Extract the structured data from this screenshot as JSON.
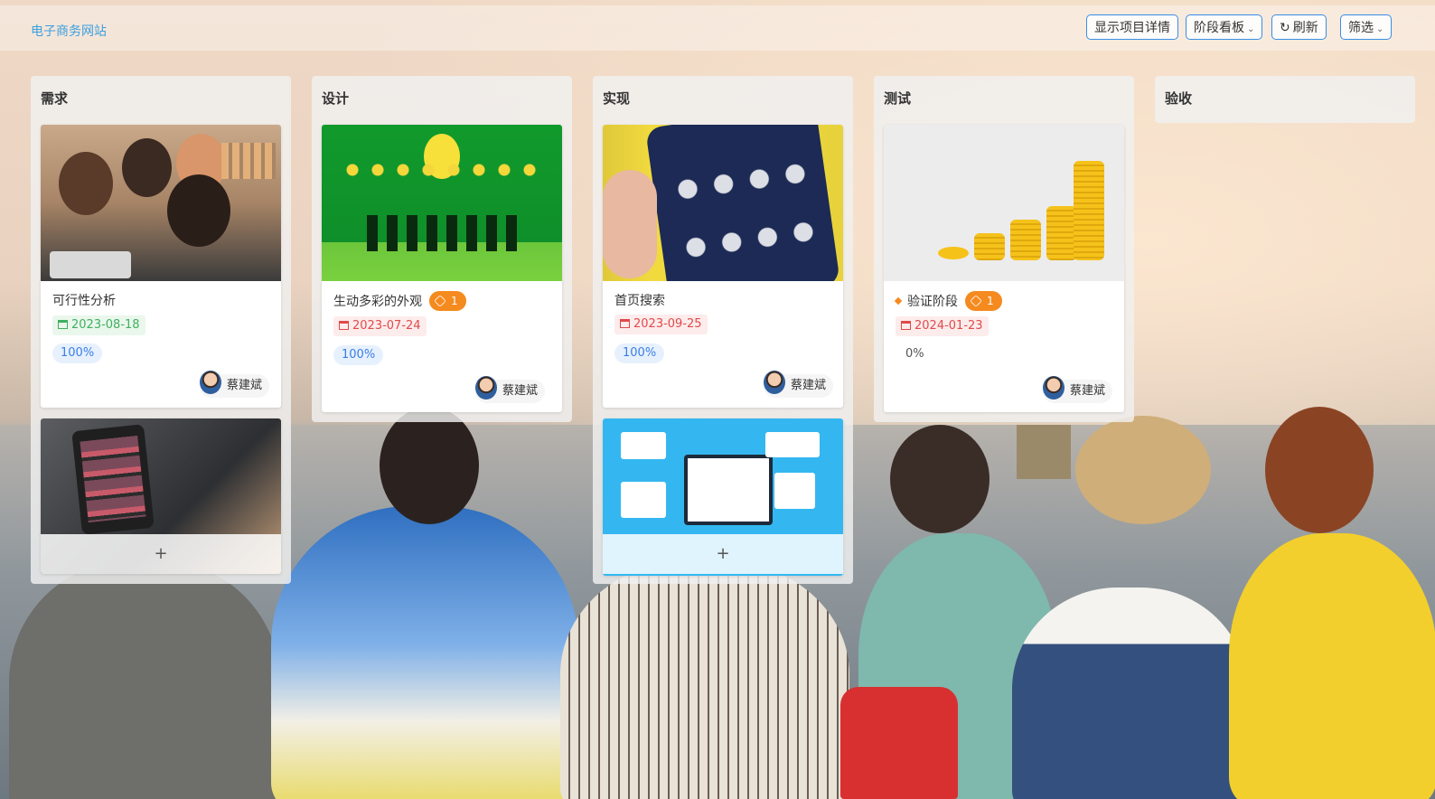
{
  "header": {
    "project_title": "电子商务网站",
    "buttons": {
      "show_details": "显示项目详情",
      "stage_board": "阶段看板",
      "refresh": "刷新",
      "filter": "筛选"
    }
  },
  "columns": [
    {
      "name": "需求",
      "cards": [
        {
          "title": "可行性分析",
          "date": "2023-08-18",
          "progress": "100%",
          "owner": "蔡建斌"
        },
        {
          "title": "",
          "add_label": "+"
        }
      ]
    },
    {
      "name": "设计",
      "cards": [
        {
          "title": "生动多彩的外观",
          "badge": "1",
          "date": "2023-07-24",
          "progress": "100%",
          "owner": "蔡建斌"
        }
      ]
    },
    {
      "name": "实现",
      "cards": [
        {
          "title": "首页搜索",
          "date": "2023-09-25",
          "progress": "100%",
          "owner": "蔡建斌"
        },
        {
          "title": "",
          "add_label": "+"
        }
      ]
    },
    {
      "name": "测试",
      "cards": [
        {
          "title": "验证阶段",
          "badge": "1",
          "date": "2024-01-23",
          "progress": "0%",
          "owner": "蔡建斌"
        }
      ]
    },
    {
      "name": "验收",
      "cards": []
    }
  ],
  "colors": {
    "accent_blue": "#3a8ee6",
    "date_green": "#3fb05f",
    "date_red": "#e04a4a",
    "badge_orange": "#f58a1f"
  }
}
